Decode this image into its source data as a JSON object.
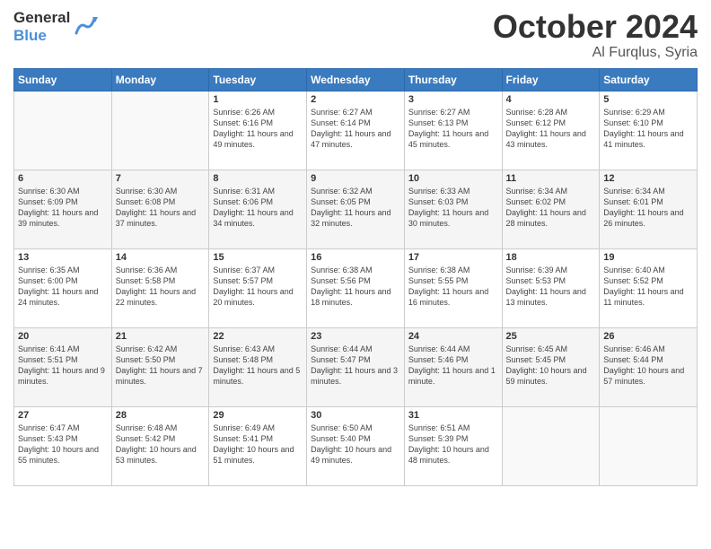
{
  "header": {
    "logo_line1": "General",
    "logo_line2": "Blue",
    "month": "October 2024",
    "location": "Al Furqlus, Syria"
  },
  "weekdays": [
    "Sunday",
    "Monday",
    "Tuesday",
    "Wednesday",
    "Thursday",
    "Friday",
    "Saturday"
  ],
  "weeks": [
    [
      {
        "day": "",
        "info": ""
      },
      {
        "day": "",
        "info": ""
      },
      {
        "day": "1",
        "info": "Sunrise: 6:26 AM\nSunset: 6:16 PM\nDaylight: 11 hours and 49 minutes."
      },
      {
        "day": "2",
        "info": "Sunrise: 6:27 AM\nSunset: 6:14 PM\nDaylight: 11 hours and 47 minutes."
      },
      {
        "day": "3",
        "info": "Sunrise: 6:27 AM\nSunset: 6:13 PM\nDaylight: 11 hours and 45 minutes."
      },
      {
        "day": "4",
        "info": "Sunrise: 6:28 AM\nSunset: 6:12 PM\nDaylight: 11 hours and 43 minutes."
      },
      {
        "day": "5",
        "info": "Sunrise: 6:29 AM\nSunset: 6:10 PM\nDaylight: 11 hours and 41 minutes."
      }
    ],
    [
      {
        "day": "6",
        "info": "Sunrise: 6:30 AM\nSunset: 6:09 PM\nDaylight: 11 hours and 39 minutes."
      },
      {
        "day": "7",
        "info": "Sunrise: 6:30 AM\nSunset: 6:08 PM\nDaylight: 11 hours and 37 minutes."
      },
      {
        "day": "8",
        "info": "Sunrise: 6:31 AM\nSunset: 6:06 PM\nDaylight: 11 hours and 34 minutes."
      },
      {
        "day": "9",
        "info": "Sunrise: 6:32 AM\nSunset: 6:05 PM\nDaylight: 11 hours and 32 minutes."
      },
      {
        "day": "10",
        "info": "Sunrise: 6:33 AM\nSunset: 6:03 PM\nDaylight: 11 hours and 30 minutes."
      },
      {
        "day": "11",
        "info": "Sunrise: 6:34 AM\nSunset: 6:02 PM\nDaylight: 11 hours and 28 minutes."
      },
      {
        "day": "12",
        "info": "Sunrise: 6:34 AM\nSunset: 6:01 PM\nDaylight: 11 hours and 26 minutes."
      }
    ],
    [
      {
        "day": "13",
        "info": "Sunrise: 6:35 AM\nSunset: 6:00 PM\nDaylight: 11 hours and 24 minutes."
      },
      {
        "day": "14",
        "info": "Sunrise: 6:36 AM\nSunset: 5:58 PM\nDaylight: 11 hours and 22 minutes."
      },
      {
        "day": "15",
        "info": "Sunrise: 6:37 AM\nSunset: 5:57 PM\nDaylight: 11 hours and 20 minutes."
      },
      {
        "day": "16",
        "info": "Sunrise: 6:38 AM\nSunset: 5:56 PM\nDaylight: 11 hours and 18 minutes."
      },
      {
        "day": "17",
        "info": "Sunrise: 6:38 AM\nSunset: 5:55 PM\nDaylight: 11 hours and 16 minutes."
      },
      {
        "day": "18",
        "info": "Sunrise: 6:39 AM\nSunset: 5:53 PM\nDaylight: 11 hours and 13 minutes."
      },
      {
        "day": "19",
        "info": "Sunrise: 6:40 AM\nSunset: 5:52 PM\nDaylight: 11 hours and 11 minutes."
      }
    ],
    [
      {
        "day": "20",
        "info": "Sunrise: 6:41 AM\nSunset: 5:51 PM\nDaylight: 11 hours and 9 minutes."
      },
      {
        "day": "21",
        "info": "Sunrise: 6:42 AM\nSunset: 5:50 PM\nDaylight: 11 hours and 7 minutes."
      },
      {
        "day": "22",
        "info": "Sunrise: 6:43 AM\nSunset: 5:48 PM\nDaylight: 11 hours and 5 minutes."
      },
      {
        "day": "23",
        "info": "Sunrise: 6:44 AM\nSunset: 5:47 PM\nDaylight: 11 hours and 3 minutes."
      },
      {
        "day": "24",
        "info": "Sunrise: 6:44 AM\nSunset: 5:46 PM\nDaylight: 11 hours and 1 minute."
      },
      {
        "day": "25",
        "info": "Sunrise: 6:45 AM\nSunset: 5:45 PM\nDaylight: 10 hours and 59 minutes."
      },
      {
        "day": "26",
        "info": "Sunrise: 6:46 AM\nSunset: 5:44 PM\nDaylight: 10 hours and 57 minutes."
      }
    ],
    [
      {
        "day": "27",
        "info": "Sunrise: 6:47 AM\nSunset: 5:43 PM\nDaylight: 10 hours and 55 minutes."
      },
      {
        "day": "28",
        "info": "Sunrise: 6:48 AM\nSunset: 5:42 PM\nDaylight: 10 hours and 53 minutes."
      },
      {
        "day": "29",
        "info": "Sunrise: 6:49 AM\nSunset: 5:41 PM\nDaylight: 10 hours and 51 minutes."
      },
      {
        "day": "30",
        "info": "Sunrise: 6:50 AM\nSunset: 5:40 PM\nDaylight: 10 hours and 49 minutes."
      },
      {
        "day": "31",
        "info": "Sunrise: 6:51 AM\nSunset: 5:39 PM\nDaylight: 10 hours and 48 minutes."
      },
      {
        "day": "",
        "info": ""
      },
      {
        "day": "",
        "info": ""
      }
    ]
  ]
}
